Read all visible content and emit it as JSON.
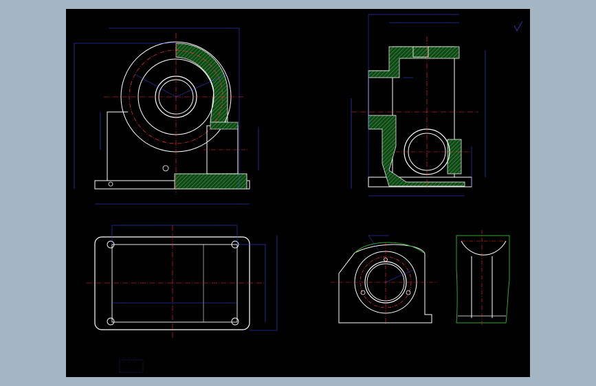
{
  "colors": {
    "background_frame": "#a4b5c4",
    "canvas": "#000000",
    "outline": "#ffffff",
    "centerline": "#ff2020",
    "dimension": "#3b4cff",
    "hatch": "#2ea82e",
    "hatch_fill": "#1f5f1f"
  },
  "drawing": {
    "title_note_lines": [
      "",
      "",
      ""
    ]
  }
}
